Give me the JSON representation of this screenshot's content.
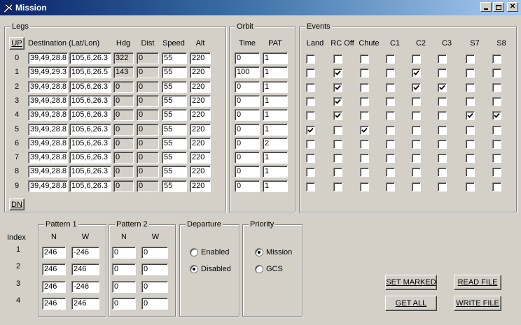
{
  "window": {
    "title": "Mission",
    "icon": "app-plane-icon",
    "controls": [
      "minimize-icon",
      "maximize-icon",
      "close-icon"
    ]
  },
  "legs": {
    "title": "Legs",
    "up_label": "UP",
    "dn_label": "DN",
    "headers": {
      "destination": "Destination (Lat/Lon)",
      "hdg": "Hdg",
      "dist": "Dist",
      "speed": "Speed",
      "alt": "Alt"
    },
    "rows": [
      {
        "idx": "0",
        "lat": "39,49,28.8",
        "lon": "105,6,26.3",
        "hdg": "322",
        "dist": "0",
        "speed": "55",
        "alt": "220"
      },
      {
        "idx": "1",
        "lat": "39,49,29.3",
        "lon": "105,6,26.5",
        "hdg": "143",
        "dist": "0",
        "speed": "55",
        "alt": "220"
      },
      {
        "idx": "2",
        "lat": "39,49,28.8",
        "lon": "105,6,26.3",
        "hdg": "0",
        "dist": "0",
        "speed": "55",
        "alt": "220"
      },
      {
        "idx": "3",
        "lat": "39,49,28.8",
        "lon": "105,6,26.3",
        "hdg": "0",
        "dist": "0",
        "speed": "55",
        "alt": "220"
      },
      {
        "idx": "4",
        "lat": "39,49,28.8",
        "lon": "105,6,26.3",
        "hdg": "0",
        "dist": "0",
        "speed": "55",
        "alt": "220"
      },
      {
        "idx": "5",
        "lat": "39,49,28.8",
        "lon": "105,6,26.3",
        "hdg": "0",
        "dist": "0",
        "speed": "55",
        "alt": "220"
      },
      {
        "idx": "6",
        "lat": "39,49,28.8",
        "lon": "105,6,26.3",
        "hdg": "0",
        "dist": "0",
        "speed": "55",
        "alt": "220"
      },
      {
        "idx": "7",
        "lat": "39,49,28.8",
        "lon": "105,6,26.3",
        "hdg": "0",
        "dist": "0",
        "speed": "55",
        "alt": "220"
      },
      {
        "idx": "8",
        "lat": "39,49,28.8",
        "lon": "105,6,26.3",
        "hdg": "0",
        "dist": "0",
        "speed": "55",
        "alt": "220"
      },
      {
        "idx": "9",
        "lat": "39,49,28.8",
        "lon": "105,6,26.3",
        "hdg": "0",
        "dist": "0",
        "speed": "55",
        "alt": "220"
      }
    ]
  },
  "orbit": {
    "title": "Orbit",
    "headers": {
      "time": "Time",
      "pat": "PAT"
    },
    "rows": [
      {
        "time": "0",
        "pat": "1"
      },
      {
        "time": "100",
        "pat": "1"
      },
      {
        "time": "0",
        "pat": "1"
      },
      {
        "time": "0",
        "pat": "1"
      },
      {
        "time": "0",
        "pat": "1"
      },
      {
        "time": "0",
        "pat": "1"
      },
      {
        "time": "0",
        "pat": "2"
      },
      {
        "time": "0",
        "pat": "1"
      },
      {
        "time": "0",
        "pat": "1"
      },
      {
        "time": "0",
        "pat": "1"
      }
    ]
  },
  "events": {
    "title": "Events",
    "columns": [
      "Land",
      "RC Off",
      "Chute",
      "C1",
      "C2",
      "C3",
      "S7",
      "S8"
    ],
    "rows": [
      [
        false,
        false,
        false,
        false,
        false,
        false,
        false,
        false
      ],
      [
        false,
        true,
        false,
        false,
        true,
        false,
        false,
        false
      ],
      [
        false,
        true,
        false,
        false,
        true,
        true,
        false,
        false
      ],
      [
        false,
        true,
        false,
        false,
        false,
        false,
        false,
        false
      ],
      [
        false,
        true,
        false,
        false,
        false,
        false,
        true,
        true
      ],
      [
        true,
        false,
        true,
        false,
        false,
        false,
        false,
        false
      ],
      [
        false,
        false,
        false,
        false,
        false,
        false,
        false,
        false
      ],
      [
        false,
        false,
        false,
        false,
        false,
        false,
        false,
        false
      ],
      [
        false,
        false,
        false,
        false,
        false,
        false,
        false,
        false
      ],
      [
        false,
        false,
        false,
        false,
        false,
        false,
        false,
        false
      ]
    ]
  },
  "patterns": {
    "index_label": "Index",
    "indices": [
      "1",
      "2",
      "3",
      "4"
    ],
    "pattern1": {
      "title": "Pattern 1",
      "n_label": "N",
      "w_label": "W",
      "rows": [
        {
          "n": "246",
          "w": "-246"
        },
        {
          "n": "246",
          "w": "246"
        },
        {
          "n": "246",
          "w": "-246"
        },
        {
          "n": "246",
          "w": "246"
        }
      ]
    },
    "pattern2": {
      "title": "Pattern 2",
      "n_label": "N",
      "w_label": "W",
      "rows": [
        {
          "n": "0",
          "w": "0"
        },
        {
          "n": "0",
          "w": "0"
        },
        {
          "n": "0",
          "w": "0"
        },
        {
          "n": "0",
          "w": "0"
        }
      ]
    }
  },
  "departure": {
    "title": "Departure",
    "options": [
      {
        "label": "Enabled",
        "selected": false
      },
      {
        "label": "Disabled",
        "selected": true
      }
    ]
  },
  "priority": {
    "title": "Priority",
    "options": [
      {
        "label": "Mission",
        "selected": true
      },
      {
        "label": "GCS",
        "selected": false
      }
    ]
  },
  "buttons": {
    "set_marked": "SET MARKED",
    "get_all": "GET ALL",
    "read_file": "READ FILE",
    "write_file": "WRITE FILE"
  }
}
